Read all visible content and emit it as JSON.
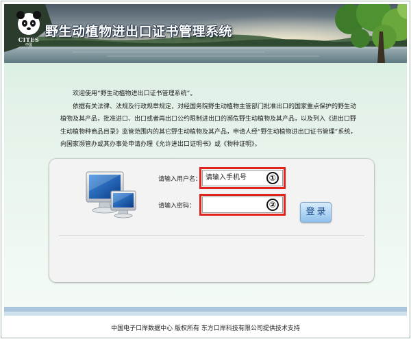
{
  "header": {
    "title": "野生动植物进出口证书管理系统",
    "logo_text": "CITES",
    "logo_subtext": "中国"
  },
  "intro": {
    "welcome": "欢迎使用“野生动植物进出口证书管理系统”。",
    "body": "依据有关法律、法规及行政规章规定，对经国务院野生动植物主管部门批准出口的国家重点保护的野生动植物及其产品，批准进口、出口或者再出口公约限制进出口的濒危野生动植物及其产品，以及列入《进出口野生动植物种商品目录》监管范围内的其它野生动植物及其产品，申请人经“野生动植物进出口证书管理”系统，向国家濒管办或其办事处申请办理《允许进出口证明书》或《物种证明》。"
  },
  "login": {
    "username_label": "请输入用户名：",
    "username_value": "请输入手机号",
    "password_label": "请输入密码：",
    "password_value": "",
    "button_label": "登录",
    "marker_1": "①",
    "marker_2": "②"
  },
  "footer": {
    "text": "中国电子口岸数据中心 版权所有 东方口岸科技有限公司提供技术支持"
  },
  "colors": {
    "accent_red": "#e0231c",
    "content_green": "#dbefe3",
    "footer_band": "#a9c6dd",
    "button_blue": "#8fc1ec"
  },
  "icons": {
    "logo": "panda-icon",
    "computer": "computer-monitors-icon"
  }
}
